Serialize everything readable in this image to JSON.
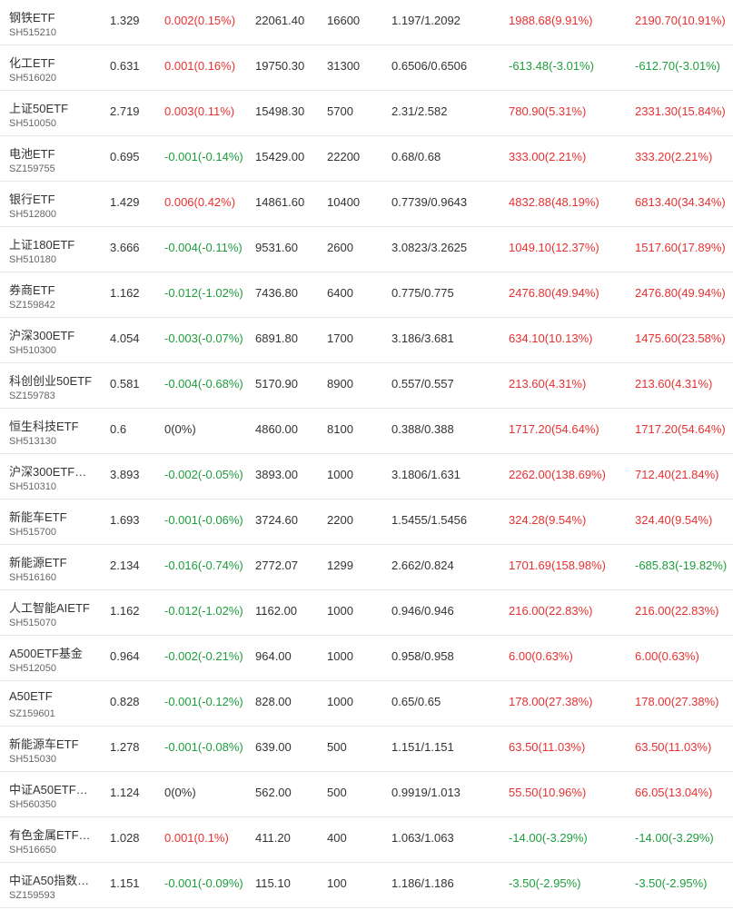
{
  "colors": {
    "up": "#e93030",
    "down": "#1e9e3c",
    "flat": "#333333",
    "code": "#666666",
    "divider": "#e9e9e9"
  },
  "holdings": [
    {
      "name": "钢铁ETF",
      "code": "SH515210",
      "price": "1.329",
      "change": "0.002(0.15%)",
      "change_dir": "up",
      "market_value": "22061.40",
      "quantity": "16600",
      "cost": "1.197/1.2092",
      "pnl_1": "1988.68(9.91%)",
      "pnl_1_dir": "up",
      "pnl_2": "2190.70(10.91%)",
      "pnl_2_dir": "up"
    },
    {
      "name": "化工ETF",
      "code": "SH516020",
      "price": "0.631",
      "change": "0.001(0.16%)",
      "change_dir": "up",
      "market_value": "19750.30",
      "quantity": "31300",
      "cost": "0.6506/0.6506",
      "pnl_1": "-613.48(-3.01%)",
      "pnl_1_dir": "down",
      "pnl_2": "-612.70(-3.01%)",
      "pnl_2_dir": "down"
    },
    {
      "name": "上证50ETF",
      "code": "SH510050",
      "price": "2.719",
      "change": "0.003(0.11%)",
      "change_dir": "up",
      "market_value": "15498.30",
      "quantity": "5700",
      "cost": "2.31/2.582",
      "pnl_1": "780.90(5.31%)",
      "pnl_1_dir": "up",
      "pnl_2": "2331.30(15.84%)",
      "pnl_2_dir": "up"
    },
    {
      "name": "电池ETF",
      "code": "SZ159755",
      "price": "0.695",
      "change": "-0.001(-0.14%)",
      "change_dir": "down",
      "market_value": "15429.00",
      "quantity": "22200",
      "cost": "0.68/0.68",
      "pnl_1": "333.00(2.21%)",
      "pnl_1_dir": "up",
      "pnl_2": "333.20(2.21%)",
      "pnl_2_dir": "up"
    },
    {
      "name": "银行ETF",
      "code": "SH512800",
      "price": "1.429",
      "change": "0.006(0.42%)",
      "change_dir": "up",
      "market_value": "14861.60",
      "quantity": "10400",
      "cost": "0.7739/0.9643",
      "pnl_1": "4832.88(48.19%)",
      "pnl_1_dir": "up",
      "pnl_2": "6813.40(34.34%)",
      "pnl_2_dir": "up"
    },
    {
      "name": "上证180ETF",
      "code": "SH510180",
      "price": "3.666",
      "change": "-0.004(-0.11%)",
      "change_dir": "down",
      "market_value": "9531.60",
      "quantity": "2600",
      "cost": "3.0823/3.2625",
      "pnl_1": "1049.10(12.37%)",
      "pnl_1_dir": "up",
      "pnl_2": "1517.60(17.89%)",
      "pnl_2_dir": "up"
    },
    {
      "name": "券商ETF",
      "code": "SZ159842",
      "price": "1.162",
      "change": "-0.012(-1.02%)",
      "change_dir": "down",
      "market_value": "7436.80",
      "quantity": "6400",
      "cost": "0.775/0.775",
      "pnl_1": "2476.80(49.94%)",
      "pnl_1_dir": "up",
      "pnl_2": "2476.80(49.94%)",
      "pnl_2_dir": "up"
    },
    {
      "name": "沪深300ETF",
      "code": "SH510300",
      "price": "4.054",
      "change": "-0.003(-0.07%)",
      "change_dir": "down",
      "market_value": "6891.80",
      "quantity": "1700",
      "cost": "3.186/3.681",
      "pnl_1": "634.10(10.13%)",
      "pnl_1_dir": "up",
      "pnl_2": "1475.60(23.58%)",
      "pnl_2_dir": "up"
    },
    {
      "name": "科创创业50ETF",
      "code": "SZ159783",
      "price": "0.581",
      "change": "-0.004(-0.68%)",
      "change_dir": "down",
      "market_value": "5170.90",
      "quantity": "8900",
      "cost": "0.557/0.557",
      "pnl_1": "213.60(4.31%)",
      "pnl_1_dir": "up",
      "pnl_2": "213.60(4.31%)",
      "pnl_2_dir": "up"
    },
    {
      "name": "恒生科技ETF",
      "code": "SH513130",
      "price": "0.6",
      "change": "0(0%)",
      "change_dir": "flat",
      "market_value": "4860.00",
      "quantity": "8100",
      "cost": "0.388/0.388",
      "pnl_1": "1717.20(54.64%)",
      "pnl_1_dir": "up",
      "pnl_2": "1717.20(54.64%)",
      "pnl_2_dir": "up"
    },
    {
      "name": "沪深300ETF…",
      "code": "SH510310",
      "price": "3.893",
      "change": "-0.002(-0.05%)",
      "change_dir": "down",
      "market_value": "3893.00",
      "quantity": "1000",
      "cost": "3.1806/1.631",
      "pnl_1": "2262.00(138.69%)",
      "pnl_1_dir": "up",
      "pnl_2": "712.40(21.84%)",
      "pnl_2_dir": "up"
    },
    {
      "name": "新能车ETF",
      "code": "SH515700",
      "price": "1.693",
      "change": "-0.001(-0.06%)",
      "change_dir": "down",
      "market_value": "3724.60",
      "quantity": "2200",
      "cost": "1.5455/1.5456",
      "pnl_1": "324.28(9.54%)",
      "pnl_1_dir": "up",
      "pnl_2": "324.40(9.54%)",
      "pnl_2_dir": "up"
    },
    {
      "name": "新能源ETF",
      "code": "SH516160",
      "price": "2.134",
      "change": "-0.016(-0.74%)",
      "change_dir": "down",
      "market_value": "2772.07",
      "quantity": "1299",
      "cost": "2.662/0.824",
      "pnl_1": "1701.69(158.98%)",
      "pnl_1_dir": "up",
      "pnl_2": "-685.83(-19.82%)",
      "pnl_2_dir": "down"
    },
    {
      "name": "人工智能AIETF",
      "code": "SH515070",
      "price": "1.162",
      "change": "-0.012(-1.02%)",
      "change_dir": "down",
      "market_value": "1162.00",
      "quantity": "1000",
      "cost": "0.946/0.946",
      "pnl_1": "216.00(22.83%)",
      "pnl_1_dir": "up",
      "pnl_2": "216.00(22.83%)",
      "pnl_2_dir": "up"
    },
    {
      "name": "A500ETF基金",
      "code": "SH512050",
      "price": "0.964",
      "change": "-0.002(-0.21%)",
      "change_dir": "down",
      "market_value": "964.00",
      "quantity": "1000",
      "cost": "0.958/0.958",
      "pnl_1": "6.00(0.63%)",
      "pnl_1_dir": "up",
      "pnl_2": "6.00(0.63%)",
      "pnl_2_dir": "up"
    },
    {
      "name": "A50ETF",
      "code": "SZ159601",
      "price": "0.828",
      "change": "-0.001(-0.12%)",
      "change_dir": "down",
      "market_value": "828.00",
      "quantity": "1000",
      "cost": "0.65/0.65",
      "pnl_1": "178.00(27.38%)",
      "pnl_1_dir": "up",
      "pnl_2": "178.00(27.38%)",
      "pnl_2_dir": "up"
    },
    {
      "name": "新能源车ETF",
      "code": "SH515030",
      "price": "1.278",
      "change": "-0.001(-0.08%)",
      "change_dir": "down",
      "market_value": "639.00",
      "quantity": "500",
      "cost": "1.151/1.151",
      "pnl_1": "63.50(11.03%)",
      "pnl_1_dir": "up",
      "pnl_2": "63.50(11.03%)",
      "pnl_2_dir": "up"
    },
    {
      "name": "中证A50ETF…",
      "code": "SH560350",
      "price": "1.124",
      "change": "0(0%)",
      "change_dir": "flat",
      "market_value": "562.00",
      "quantity": "500",
      "cost": "0.9919/1.013",
      "pnl_1": "55.50(10.96%)",
      "pnl_1_dir": "up",
      "pnl_2": "66.05(13.04%)",
      "pnl_2_dir": "up"
    },
    {
      "name": "有色金属ETF…",
      "code": "SH516650",
      "price": "1.028",
      "change": "0.001(0.1%)",
      "change_dir": "up",
      "market_value": "411.20",
      "quantity": "400",
      "cost": "1.063/1.063",
      "pnl_1": "-14.00(-3.29%)",
      "pnl_1_dir": "down",
      "pnl_2": "-14.00(-3.29%)",
      "pnl_2_dir": "down"
    },
    {
      "name": "中证A50指数…",
      "code": "SZ159593",
      "price": "1.151",
      "change": "-0.001(-0.09%)",
      "change_dir": "down",
      "market_value": "115.10",
      "quantity": "100",
      "cost": "1.186/1.186",
      "pnl_1": "-3.50(-2.95%)",
      "pnl_1_dir": "down",
      "pnl_2": "-3.50(-2.95%)",
      "pnl_2_dir": "down"
    }
  ]
}
